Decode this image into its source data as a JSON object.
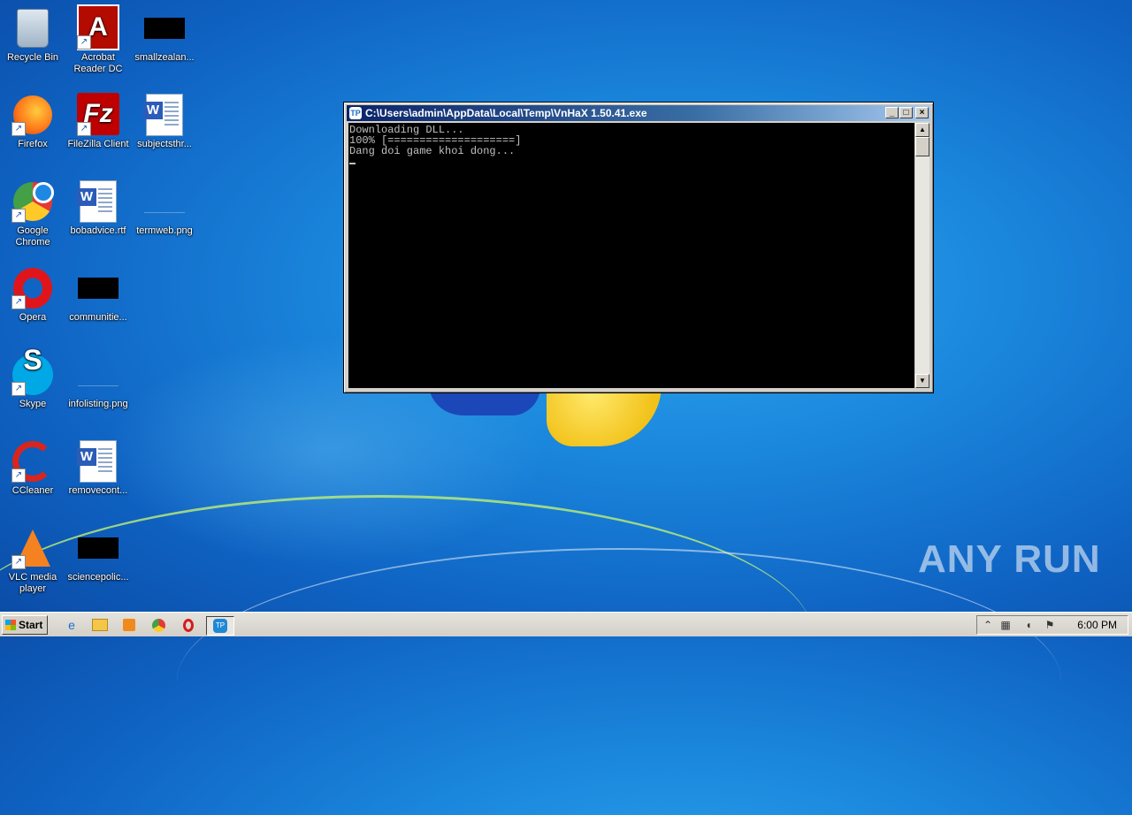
{
  "desktop": {
    "icons": [
      {
        "label": "Recycle Bin"
      },
      {
        "label": "Acrobat Reader DC"
      },
      {
        "label": "smallzealan..."
      },
      {
        "label": "Firefox"
      },
      {
        "label": "FileZilla Client"
      },
      {
        "label": "subjectsthr..."
      },
      {
        "label": "Google Chrome"
      },
      {
        "label": "bobadvice.rtf"
      },
      {
        "label": "termweb.png"
      },
      {
        "label": "Opera"
      },
      {
        "label": "communitie..."
      },
      {
        "label": "Skype"
      },
      {
        "label": "infolisting.png"
      },
      {
        "label": "CCleaner"
      },
      {
        "label": "removecont..."
      },
      {
        "label": "VLC media player"
      },
      {
        "label": "sciencepolic..."
      }
    ],
    "glyphs": {
      "acrobat": "A",
      "filezilla": "Fz",
      "word": "W",
      "skype": "S",
      "shortcut_arrow": "↗"
    }
  },
  "console_window": {
    "title": "C:\\Users\\admin\\AppData\\Local\\Temp\\VnHaX 1.50.41.exe",
    "app_icon": "TP",
    "lines": [
      "Downloading DLL...",
      "100% [====================]",
      "Dang doi game khoi dong..."
    ],
    "buttons": {
      "minimize": "_",
      "maximize": "□",
      "close": "×"
    },
    "scroll": {
      "up": "▲",
      "down": "▼"
    }
  },
  "taskbar": {
    "start_label": "Start",
    "clock": "6:00 PM",
    "tray_expand": "⌃"
  },
  "watermark": "ANY RUN"
}
